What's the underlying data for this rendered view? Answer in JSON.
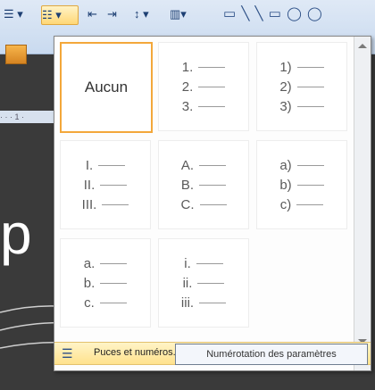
{
  "toolbar": {
    "bullets_icon": "bullet-list-icon",
    "numbering_icon": "numbered-list-icon",
    "decrease_indent_icon": "decrease-indent-icon",
    "increase_indent_icon": "increase-indent-icon",
    "line_spacing_icon": "line-spacing-icon",
    "columns_icon": "columns-icon",
    "shapes_icon": "shapes-gallery-icon"
  },
  "ruler_text": "· · · 1 ·",
  "slide_text": "p",
  "numbering_gallery": {
    "none_label": "Aucun",
    "formats": [
      [
        "1.",
        "2.",
        "3."
      ],
      [
        "1)",
        "2)",
        "3)"
      ],
      [
        "I.",
        "II.",
        "III."
      ],
      [
        "A.",
        "B.",
        "C."
      ],
      [
        "a)",
        "b)",
        "c)"
      ],
      [
        "a.",
        "b.",
        "c."
      ],
      [
        "i.",
        "ii.",
        "iii."
      ]
    ]
  },
  "footer": {
    "label": "Puces et numéros...",
    "icon": "bullets-numbering-icon"
  },
  "tooltip": "Numérotation des paramètres",
  "colors": {
    "selection_border": "#f3a73a",
    "hover_footer": "#ffe28d",
    "ribbon": "#dfe9f6"
  }
}
